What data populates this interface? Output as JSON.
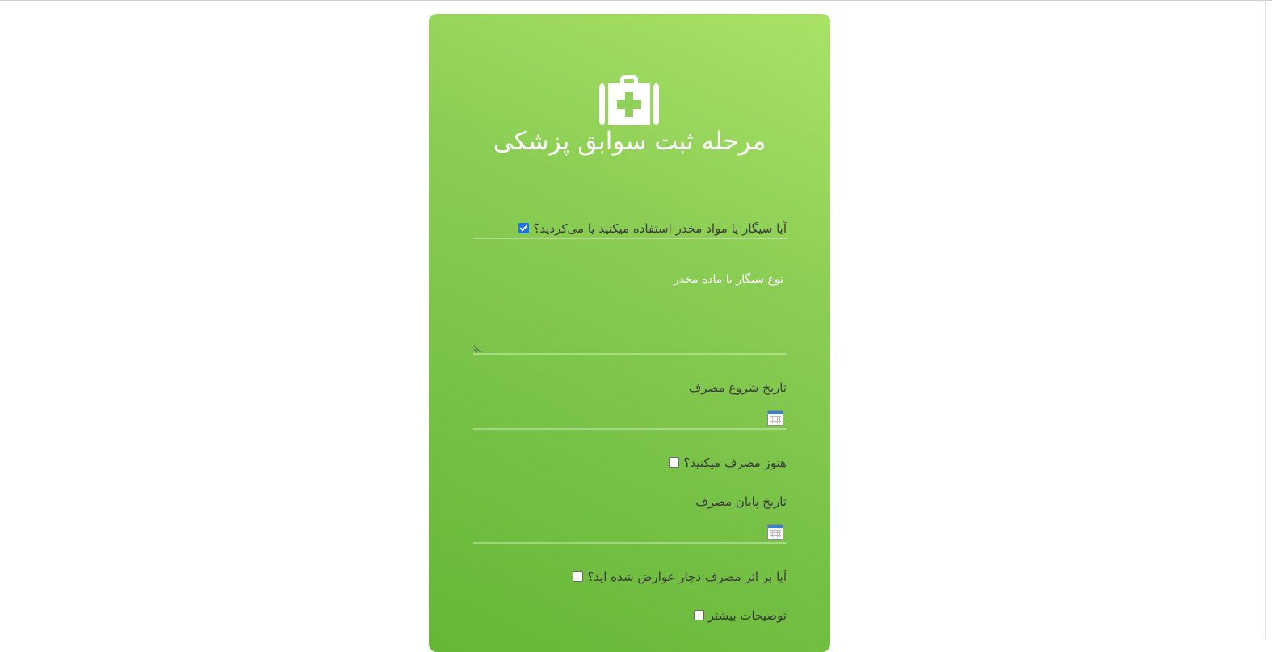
{
  "form": {
    "title": "مرحله ثبت سوابق پزشکی",
    "smoking_question": "آیا سیگار یا مواد مخدر استفاده میکنید یا می‌کردید؟",
    "smoking_checked": true,
    "type_placeholder": "نوع سیگار یا ماده مخدر",
    "start_date_label": "تاریخ شروع مصرف",
    "still_using_label": "هنوز مصرف میکنید؟",
    "still_using_checked": false,
    "end_date_label": "تاریخ پایان مصرف",
    "side_effects_label": "آیا بر اثر مصرف دچار عوارض شده اید؟",
    "side_effects_checked": false,
    "more_details_label": "توضیحات بیشتر",
    "more_details_checked": false
  },
  "colors": {
    "card_gradient_light": "#abe268",
    "card_gradient_dark": "#66b637",
    "text_dark": "#3a3a3a",
    "text_light": "#ffffff",
    "checkbox_accent": "#1a73e8"
  },
  "icons": {
    "logo": "medical-kit-icon",
    "calendar": "calendar-icon",
    "resize": "textarea-resize-icon"
  }
}
